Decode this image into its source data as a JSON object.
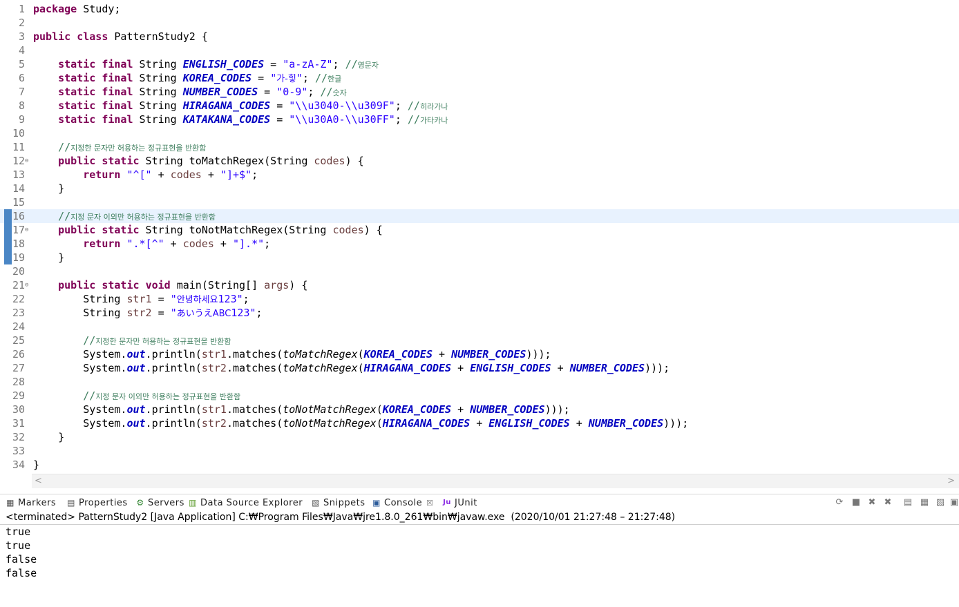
{
  "editor": {
    "lines": [
      {
        "n": "1",
        "fold": "",
        "tokens": [
          {
            "t": "package",
            "c": "kw"
          },
          {
            "t": " Study;",
            "c": ""
          }
        ]
      },
      {
        "n": "2",
        "fold": "",
        "tokens": []
      },
      {
        "n": "3",
        "fold": "",
        "tokens": [
          {
            "t": "public",
            "c": "kw"
          },
          {
            "t": " ",
            "c": ""
          },
          {
            "t": "class",
            "c": "kw"
          },
          {
            "t": " PatternStudy2 {",
            "c": ""
          }
        ]
      },
      {
        "n": "4",
        "fold": "",
        "tokens": []
      },
      {
        "n": "5",
        "fold": "",
        "tokens": [
          {
            "t": "    ",
            "c": ""
          },
          {
            "t": "static",
            "c": "kw"
          },
          {
            "t": " ",
            "c": ""
          },
          {
            "t": "final",
            "c": "kw"
          },
          {
            "t": " String ",
            "c": ""
          },
          {
            "t": "ENGLISH_CODES",
            "c": "sc"
          },
          {
            "t": " = ",
            "c": ""
          },
          {
            "t": "\"a-zA-Z\"",
            "c": "str"
          },
          {
            "t": "; ",
            "c": ""
          },
          {
            "t": "//",
            "c": "cm"
          },
          {
            "t": "영문자",
            "c": "cmk"
          }
        ]
      },
      {
        "n": "6",
        "fold": "",
        "tokens": [
          {
            "t": "    ",
            "c": ""
          },
          {
            "t": "static",
            "c": "kw"
          },
          {
            "t": " ",
            "c": ""
          },
          {
            "t": "final",
            "c": "kw"
          },
          {
            "t": " String ",
            "c": ""
          },
          {
            "t": "KOREA_CODES",
            "c": "sc"
          },
          {
            "t": " = ",
            "c": ""
          },
          {
            "t": "\"",
            "c": "str"
          },
          {
            "t": "가-힣",
            "c": "strk"
          },
          {
            "t": "\"",
            "c": "str"
          },
          {
            "t": "; ",
            "c": ""
          },
          {
            "t": "//",
            "c": "cm"
          },
          {
            "t": "한글",
            "c": "cmk"
          }
        ]
      },
      {
        "n": "7",
        "fold": "",
        "tokens": [
          {
            "t": "    ",
            "c": ""
          },
          {
            "t": "static",
            "c": "kw"
          },
          {
            "t": " ",
            "c": ""
          },
          {
            "t": "final",
            "c": "kw"
          },
          {
            "t": " String ",
            "c": ""
          },
          {
            "t": "NUMBER_CODES",
            "c": "sc"
          },
          {
            "t": " = ",
            "c": ""
          },
          {
            "t": "\"0-9\"",
            "c": "str"
          },
          {
            "t": "; ",
            "c": ""
          },
          {
            "t": "//",
            "c": "cm"
          },
          {
            "t": "숫자",
            "c": "cmk"
          }
        ]
      },
      {
        "n": "8",
        "fold": "",
        "tokens": [
          {
            "t": "    ",
            "c": ""
          },
          {
            "t": "static",
            "c": "kw"
          },
          {
            "t": " ",
            "c": ""
          },
          {
            "t": "final",
            "c": "kw"
          },
          {
            "t": " String ",
            "c": ""
          },
          {
            "t": "HIRAGANA_CODES",
            "c": "sc"
          },
          {
            "t": " = ",
            "c": ""
          },
          {
            "t": "\"\\\\u3040-\\\\u309F\"",
            "c": "str"
          },
          {
            "t": "; ",
            "c": ""
          },
          {
            "t": "//",
            "c": "cm"
          },
          {
            "t": "히라가나",
            "c": "cmk"
          }
        ]
      },
      {
        "n": "9",
        "fold": "",
        "tokens": [
          {
            "t": "    ",
            "c": ""
          },
          {
            "t": "static",
            "c": "kw"
          },
          {
            "t": " ",
            "c": ""
          },
          {
            "t": "final",
            "c": "kw"
          },
          {
            "t": " String ",
            "c": ""
          },
          {
            "t": "KATAKANA_CODES",
            "c": "sc"
          },
          {
            "t": " = ",
            "c": ""
          },
          {
            "t": "\"\\\\u30A0-\\\\u30FF\"",
            "c": "str"
          },
          {
            "t": "; ",
            "c": ""
          },
          {
            "t": "//",
            "c": "cm"
          },
          {
            "t": "가타카나",
            "c": "cmk"
          }
        ]
      },
      {
        "n": "10",
        "fold": "",
        "tokens": []
      },
      {
        "n": "11",
        "fold": "",
        "tokens": [
          {
            "t": "    ",
            "c": ""
          },
          {
            "t": "//",
            "c": "cm"
          },
          {
            "t": "지정한 문자만 허용하는 정규표현을 반환함",
            "c": "cmk"
          }
        ]
      },
      {
        "n": "12",
        "fold": "⊖",
        "tokens": [
          {
            "t": "    ",
            "c": ""
          },
          {
            "t": "public",
            "c": "kw"
          },
          {
            "t": " ",
            "c": ""
          },
          {
            "t": "static",
            "c": "kw"
          },
          {
            "t": " String toMatchRegex(String ",
            "c": ""
          },
          {
            "t": "codes",
            "c": "var"
          },
          {
            "t": ") {",
            "c": ""
          }
        ]
      },
      {
        "n": "13",
        "fold": "",
        "tokens": [
          {
            "t": "        ",
            "c": ""
          },
          {
            "t": "return",
            "c": "kw"
          },
          {
            "t": " ",
            "c": ""
          },
          {
            "t": "\"^[\"",
            "c": "str"
          },
          {
            "t": " + ",
            "c": ""
          },
          {
            "t": "codes",
            "c": "var"
          },
          {
            "t": " + ",
            "c": ""
          },
          {
            "t": "\"]+$\"",
            "c": "str"
          },
          {
            "t": ";",
            "c": ""
          }
        ]
      },
      {
        "n": "14",
        "fold": "",
        "tokens": [
          {
            "t": "    }",
            "c": ""
          }
        ]
      },
      {
        "n": "15",
        "fold": "",
        "tokens": []
      },
      {
        "n": "16",
        "fold": "",
        "hl": true,
        "tokens": [
          {
            "t": "    ",
            "c": ""
          },
          {
            "t": "//",
            "c": "cm"
          },
          {
            "t": "지정 문자 이외만 허용하는 정규표현을 반환함",
            "c": "cmk"
          }
        ]
      },
      {
        "n": "17",
        "fold": "⊖",
        "tokens": [
          {
            "t": "    ",
            "c": ""
          },
          {
            "t": "public",
            "c": "kw"
          },
          {
            "t": " ",
            "c": ""
          },
          {
            "t": "static",
            "c": "kw"
          },
          {
            "t": " String toNotMatchRegex(String ",
            "c": ""
          },
          {
            "t": "codes",
            "c": "var"
          },
          {
            "t": ") {",
            "c": ""
          }
        ]
      },
      {
        "n": "18",
        "fold": "",
        "tokens": [
          {
            "t": "        ",
            "c": ""
          },
          {
            "t": "return",
            "c": "kw"
          },
          {
            "t": " ",
            "c": ""
          },
          {
            "t": "\".*[^\"",
            "c": "str"
          },
          {
            "t": " + ",
            "c": ""
          },
          {
            "t": "codes",
            "c": "var"
          },
          {
            "t": " + ",
            "c": ""
          },
          {
            "t": "\"].*\"",
            "c": "str"
          },
          {
            "t": ";",
            "c": ""
          }
        ]
      },
      {
        "n": "19",
        "fold": "",
        "tokens": [
          {
            "t": "    }",
            "c": ""
          }
        ]
      },
      {
        "n": "20",
        "fold": "",
        "tokens": []
      },
      {
        "n": "21",
        "fold": "⊖",
        "tokens": [
          {
            "t": "    ",
            "c": ""
          },
          {
            "t": "public",
            "c": "kw"
          },
          {
            "t": " ",
            "c": ""
          },
          {
            "t": "static",
            "c": "kw"
          },
          {
            "t": " ",
            "c": ""
          },
          {
            "t": "void",
            "c": "kw"
          },
          {
            "t": " main(String[] ",
            "c": ""
          },
          {
            "t": "args",
            "c": "var"
          },
          {
            "t": ") {",
            "c": ""
          }
        ]
      },
      {
        "n": "22",
        "fold": "",
        "tokens": [
          {
            "t": "        String ",
            "c": ""
          },
          {
            "t": "str1",
            "c": "var"
          },
          {
            "t": " = ",
            "c": ""
          },
          {
            "t": "\"",
            "c": "str"
          },
          {
            "t": "안녕하세요",
            "c": "strk"
          },
          {
            "t": "123\"",
            "c": "str"
          },
          {
            "t": ";",
            "c": ""
          }
        ]
      },
      {
        "n": "23",
        "fold": "",
        "tokens": [
          {
            "t": "        String ",
            "c": ""
          },
          {
            "t": "str2",
            "c": "var"
          },
          {
            "t": " = ",
            "c": ""
          },
          {
            "t": "\"",
            "c": "str"
          },
          {
            "t": "あいうえABC",
            "c": "strk"
          },
          {
            "t": "123\"",
            "c": "str"
          },
          {
            "t": ";",
            "c": ""
          }
        ]
      },
      {
        "n": "24",
        "fold": "",
        "tokens": []
      },
      {
        "n": "25",
        "fold": "",
        "tokens": [
          {
            "t": "        ",
            "c": ""
          },
          {
            "t": "//",
            "c": "cm"
          },
          {
            "t": "지정한 문자만 허용하는 정규표현을 반환함",
            "c": "cmk"
          }
        ]
      },
      {
        "n": "26",
        "fold": "",
        "tokens": [
          {
            "t": "        System.",
            "c": ""
          },
          {
            "t": "out",
            "c": "fld"
          },
          {
            "t": ".println(",
            "c": ""
          },
          {
            "t": "str1",
            "c": "var"
          },
          {
            "t": ".matches(",
            "c": ""
          },
          {
            "t": "toMatchRegex",
            "c": "sm"
          },
          {
            "t": "(",
            "c": ""
          },
          {
            "t": "KOREA_CODES",
            "c": "sc"
          },
          {
            "t": " + ",
            "c": ""
          },
          {
            "t": "NUMBER_CODES",
            "c": "sc"
          },
          {
            "t": ")));",
            "c": ""
          }
        ]
      },
      {
        "n": "27",
        "fold": "",
        "tokens": [
          {
            "t": "        System.",
            "c": ""
          },
          {
            "t": "out",
            "c": "fld"
          },
          {
            "t": ".println(",
            "c": ""
          },
          {
            "t": "str2",
            "c": "var"
          },
          {
            "t": ".matches(",
            "c": ""
          },
          {
            "t": "toMatchRegex",
            "c": "sm"
          },
          {
            "t": "(",
            "c": ""
          },
          {
            "t": "HIRAGANA_CODES",
            "c": "sc"
          },
          {
            "t": " + ",
            "c": ""
          },
          {
            "t": "ENGLISH_CODES",
            "c": "sc"
          },
          {
            "t": " + ",
            "c": ""
          },
          {
            "t": "NUMBER_CODES",
            "c": "sc"
          },
          {
            "t": ")));",
            "c": ""
          }
        ]
      },
      {
        "n": "28",
        "fold": "",
        "tokens": []
      },
      {
        "n": "29",
        "fold": "",
        "tokens": [
          {
            "t": "        ",
            "c": ""
          },
          {
            "t": "//",
            "c": "cm"
          },
          {
            "t": "지정 문자 이외만 허용하는 정규표현을 반환함",
            "c": "cmk"
          }
        ]
      },
      {
        "n": "30",
        "fold": "",
        "tokens": [
          {
            "t": "        System.",
            "c": ""
          },
          {
            "t": "out",
            "c": "fld"
          },
          {
            "t": ".println(",
            "c": ""
          },
          {
            "t": "str1",
            "c": "var"
          },
          {
            "t": ".matches(",
            "c": ""
          },
          {
            "t": "toNotMatchRegex",
            "c": "sm"
          },
          {
            "t": "(",
            "c": ""
          },
          {
            "t": "KOREA_CODES",
            "c": "sc"
          },
          {
            "t": " + ",
            "c": ""
          },
          {
            "t": "NUMBER_CODES",
            "c": "sc"
          },
          {
            "t": ")));",
            "c": ""
          }
        ]
      },
      {
        "n": "31",
        "fold": "",
        "tokens": [
          {
            "t": "        System.",
            "c": ""
          },
          {
            "t": "out",
            "c": "fld"
          },
          {
            "t": ".println(",
            "c": ""
          },
          {
            "t": "str2",
            "c": "var"
          },
          {
            "t": ".matches(",
            "c": ""
          },
          {
            "t": "toNotMatchRegex",
            "c": "sm"
          },
          {
            "t": "(",
            "c": ""
          },
          {
            "t": "HIRAGANA_CODES",
            "c": "sc"
          },
          {
            "t": " + ",
            "c": ""
          },
          {
            "t": "ENGLISH_CODES",
            "c": "sc"
          },
          {
            "t": " + ",
            "c": ""
          },
          {
            "t": "NUMBER_CODES",
            "c": "sc"
          },
          {
            "t": ")));",
            "c": ""
          }
        ]
      },
      {
        "n": "32",
        "fold": "",
        "tokens": [
          {
            "t": "    }",
            "c": ""
          }
        ]
      },
      {
        "n": "33",
        "fold": "",
        "tokens": []
      },
      {
        "n": "34",
        "fold": "",
        "tokens": [
          {
            "t": "}",
            "c": ""
          }
        ]
      }
    ]
  },
  "panel": {
    "tabs": [
      {
        "label": "Markers",
        "icon": "markers-icon",
        "glyph": "▦"
      },
      {
        "label": "Properties",
        "icon": "properties-icon",
        "glyph": "▤"
      },
      {
        "label": "Servers",
        "icon": "servers-icon",
        "glyph": "⚙"
      },
      {
        "label": "Data Source Explorer",
        "icon": "data-source-icon",
        "glyph": "▥"
      },
      {
        "label": "Snippets",
        "icon": "snippets-icon",
        "glyph": "▧"
      },
      {
        "label": "Console",
        "icon": "console-icon",
        "glyph": "▣",
        "active": true
      },
      {
        "label": "JUnit",
        "icon": "junit-icon",
        "glyph": "Ju"
      }
    ],
    "close_glyph": "☒",
    "toolbar": [
      {
        "icon": "pin-icon",
        "glyph": "⟳"
      },
      {
        "icon": "terminate-icon",
        "glyph": "■"
      },
      {
        "icon": "remove-launch-icon",
        "glyph": "✖"
      },
      {
        "icon": "remove-all-icon",
        "glyph": "✖"
      },
      {
        "icon": "scroll-lock-icon",
        "glyph": "▤"
      },
      {
        "icon": "show-console-icon",
        "glyph": "▦"
      },
      {
        "icon": "open-console-icon",
        "glyph": "▧"
      },
      {
        "icon": "display-selected-icon",
        "glyph": "▣"
      }
    ],
    "status": "<terminated> PatternStudy2 [Java Application] C:₩Program Files₩Java₩jre1.8.0_261₩bin₩javaw.exe  (2020/10/01 21:27:48 – 21:27:48)",
    "output": [
      "true",
      "true",
      "false",
      "false"
    ]
  },
  "scrollbar": {
    "left": "<",
    "right": ">"
  }
}
